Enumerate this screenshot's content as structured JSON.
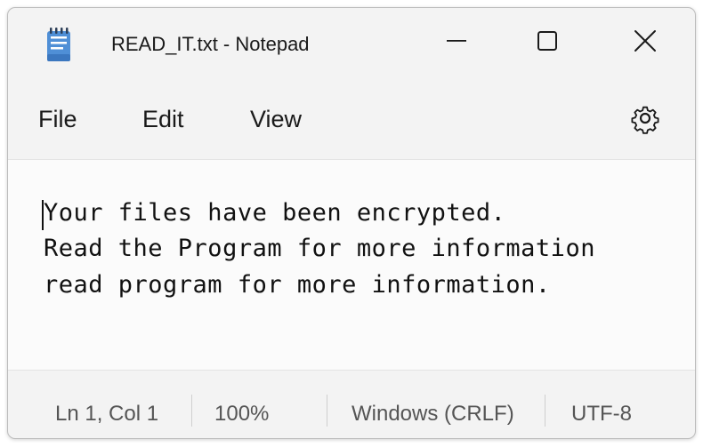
{
  "window": {
    "title": "READ_IT.txt - Notepad",
    "app_icon": "notepad-icon",
    "controls": {
      "minimize": "minimize-icon",
      "maximize": "maximize-icon",
      "close": "close-icon"
    }
  },
  "menu": {
    "items": [
      {
        "label": "File"
      },
      {
        "label": "Edit"
      },
      {
        "label": "View"
      }
    ],
    "settings_icon": "gear-icon"
  },
  "editor": {
    "lines": [
      "Your files have been encrypted.",
      "Read the Program for more information",
      "read program for more information."
    ]
  },
  "status": {
    "position": "Ln 1, Col 1",
    "zoom": "100%",
    "line_ending": "Windows (CRLF)",
    "encoding": "UTF-8"
  },
  "colors": {
    "window_bg": "#f3f3f3",
    "editor_bg": "#fbfbfb",
    "text": "#111111"
  }
}
